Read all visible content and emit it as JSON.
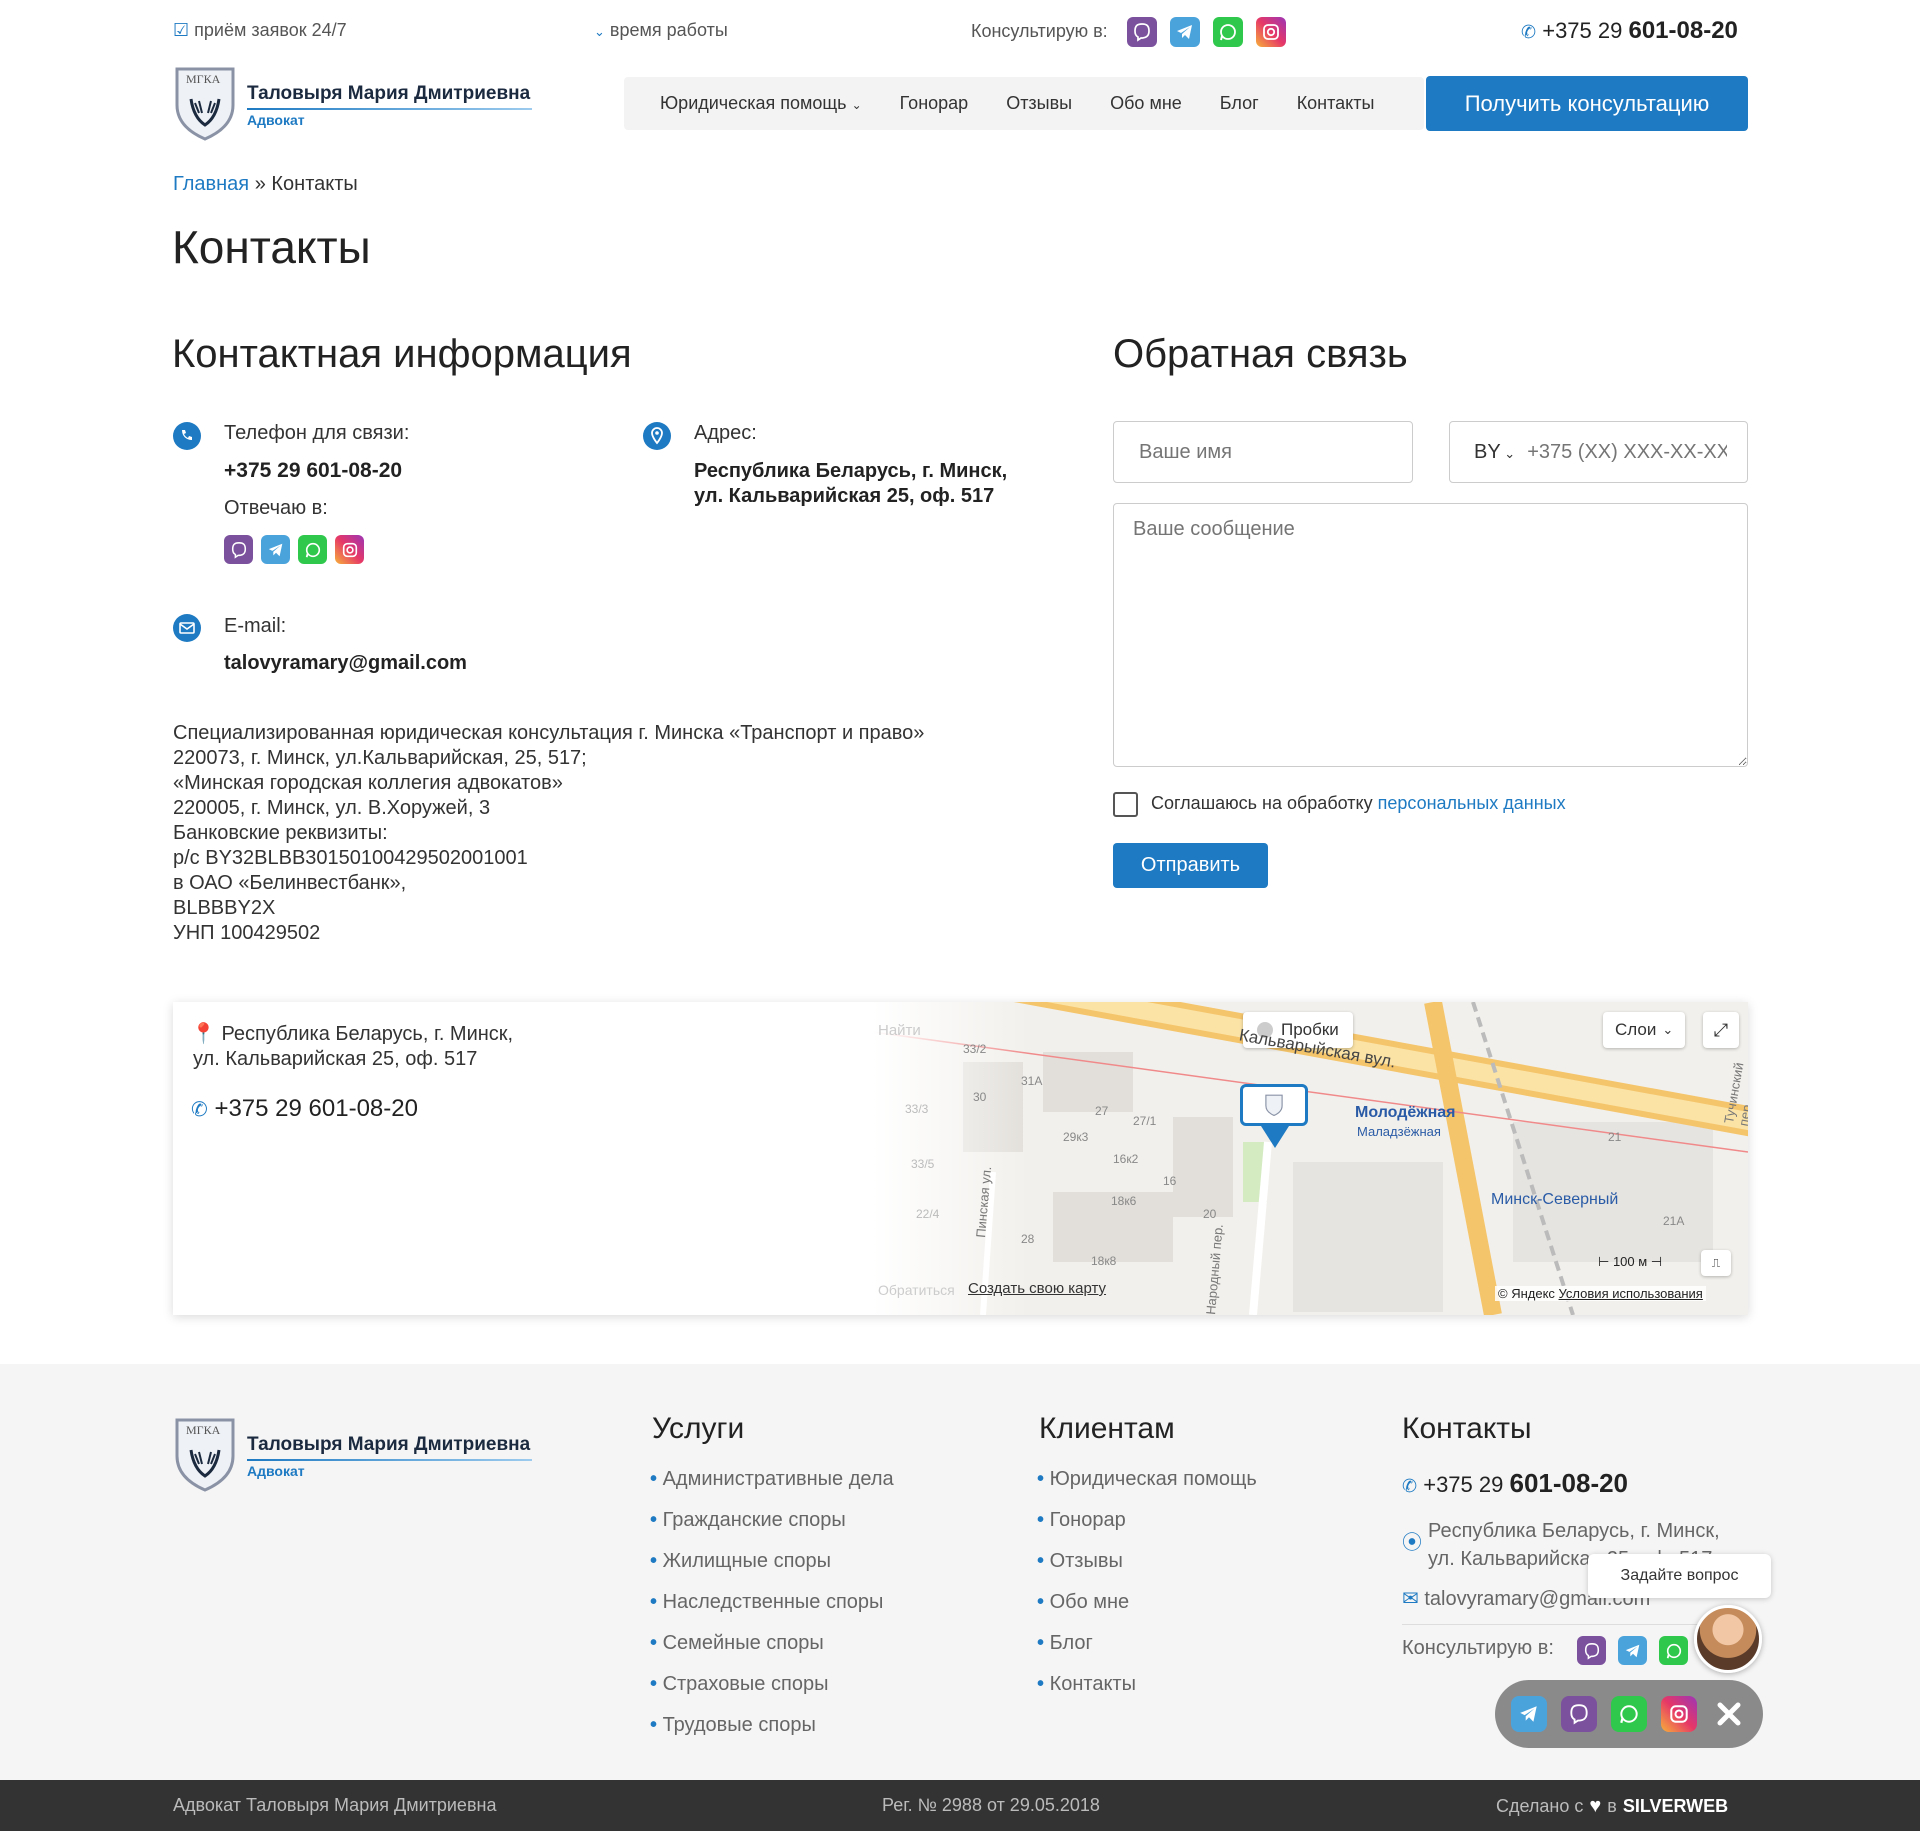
{
  "topbar": {
    "requests": "приём заявок 24/7",
    "hours": "время работы",
    "consult_label": "Консультирую в:",
    "phone_prefix": "+375 29",
    "phone_main": "601-08-20"
  },
  "logo": {
    "emblem": "МГКА",
    "name": "Таловыря Мария Дмитриевна",
    "sub": "Адвокат"
  },
  "nav": {
    "items": [
      "Юридическая помощь",
      "Гонорар",
      "Отзывы",
      "Обо мне",
      "Блог",
      "Контакты"
    ],
    "cta": "Получить консультацию"
  },
  "breadcrumb": {
    "home": "Главная",
    "sep": "»",
    "current": "Контакты"
  },
  "page_title": "Контакты",
  "contact_info": {
    "heading": "Контактная информация",
    "phone_label": "Телефон для связи:",
    "phone": "+375 29 601-08-20",
    "reply_label": "Отвечаю в:",
    "address_label": "Адрес:",
    "address_line1": "Республика Беларусь, г. Минск,",
    "address_line2": "ул. Кальварийская 25, оф. 517",
    "email_label": "E-mail:",
    "email": "talovyramary@gmail.com",
    "details": [
      "Специализированная юридическая консультация г. Минска «Транспорт и право»",
      "220073, г. Минск, ул.Кальварийская, 25, 517;",
      "«Минская городская коллегия адвокатов»",
      "220005, г. Минск, ул. В.Хоружей, 3",
      "Банковские реквизиты:",
      "р/с BY32BLBB30150100429502001001",
      "в ОАО «Белинвестбанк»,",
      "BLBBBY2X",
      "УНП 100429502"
    ]
  },
  "feedback": {
    "heading": "Обратная связь",
    "name_placeholder": "Ваше имя",
    "country": "BY",
    "phone_placeholder": "+375 (XX) XXX-XX-XX",
    "message_placeholder": "Ваше сообщение",
    "consent_text": "Соглашаюсь на обработку",
    "consent_link": "персональных данных",
    "submit": "Отправить"
  },
  "map": {
    "address_line1": "Республика Беларусь, г. Минск,",
    "address_line2": "ул. Кальварийская 25, оф. 517",
    "phone": "+375 29 601-08-20",
    "traffic": "Пробки",
    "layers": "Слои",
    "street1": "Кальварыйская вул.",
    "metro": "Молодёжная",
    "metro_by": "Маладзёжная",
    "station": "Минск-Северный",
    "street2": "Пинская ул.",
    "street3": "Тучинский пер.",
    "street4": "Народный пер.",
    "houses": [
      "33/2",
      "31А",
      "30",
      "27",
      "27/1",
      "29к3",
      "16к2",
      "16",
      "18к6",
      "20",
      "28",
      "18к8",
      "33/3",
      "33/5",
      "22/4",
      "21",
      "21А"
    ],
    "search_stub": "Найти",
    "feedback_stub": "Обратиться",
    "create_map": "Создать свою карту",
    "scale": "100 м",
    "copyright": "© Яндекс",
    "terms": "Условия использования"
  },
  "footer": {
    "services_heading": "Услуги",
    "services": [
      "Административные дела",
      "Гражданские споры",
      "Жилищные споры",
      "Наследственные споры",
      "Семейные споры",
      "Страховые споры",
      "Трудовые споры"
    ],
    "clients_heading": "Клиентам",
    "clients": [
      "Юридическая помощь",
      "Гонорар",
      "Отзывы",
      "Обо мне",
      "Блог",
      "Контакты"
    ],
    "contacts_heading": "Контакты",
    "phone_prefix": "+375 29",
    "phone_main": "601-08-20",
    "address_line1": "Республика Беларусь, г. Минск,",
    "address_line2": "ул. Кальварийская 25, оф. 517",
    "email": "talovyramary@gmail.com",
    "consult_label": "Консультирую в:"
  },
  "widget": {
    "tooltip": "Задайте вопрос"
  },
  "bottom": {
    "left": "Адвокат Таловыря Мария Дмитриевна",
    "center": "Рег. № 2988 от 29.05.2018",
    "made_with": "Сделано с",
    "in": "в",
    "brand": "SILVERWEB"
  },
  "colors": {
    "accent": "#1e7ac2",
    "viber": "#7b519d",
    "telegram": "#4ba3dc",
    "whatsapp": "#2fc84c",
    "footer_bg": "#f5f5f5",
    "bottom_bg": "#333333"
  }
}
